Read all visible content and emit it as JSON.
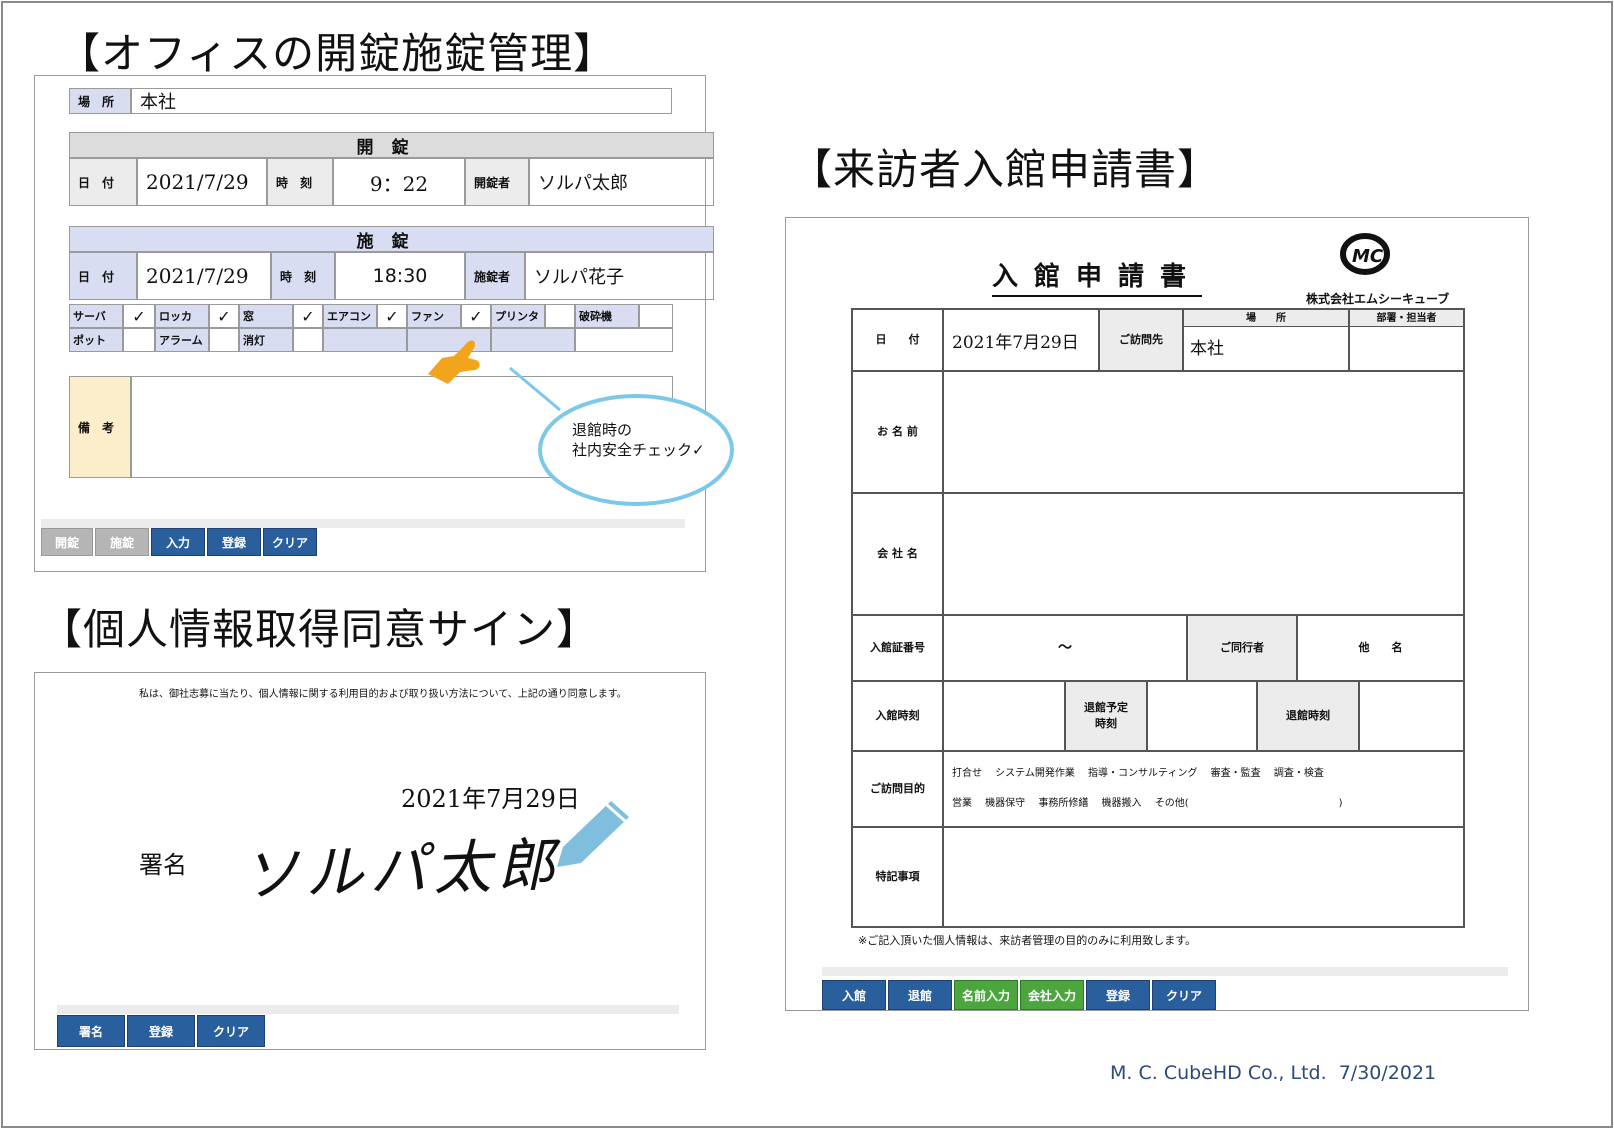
{
  "headings": {
    "office": "【オフィスの開錠施錠管理】",
    "visitor": "【来訪者入館申請書】",
    "consent": "【個人情報取得同意サイン】"
  },
  "lock_panel": {
    "place_label": "場　所",
    "place_value": "本社",
    "unlock_header": "開錠",
    "unlock": {
      "date_label": "日　付",
      "date": "2021/7/29",
      "time_label": "時　刻",
      "time": "9：22",
      "person_label": "開錠者",
      "person": "ソルパ太郎"
    },
    "lock_header": "施錠",
    "lock": {
      "date_label": "日　付",
      "date": "2021/7/29",
      "time_label": "時　刻",
      "time": "18:30",
      "person_label": "施錠者",
      "person": "ソルパ花子"
    },
    "checks_row1": [
      {
        "label": "サーバ",
        "mark": "✓"
      },
      {
        "label": "ロッカ",
        "mark": "✓"
      },
      {
        "label": "窓",
        "mark": "✓"
      },
      {
        "label": "エアコン",
        "mark": "✓"
      },
      {
        "label": "ファン",
        "mark": "✓"
      },
      {
        "label": "プリンタ",
        "mark": ""
      },
      {
        "label": "破砕機",
        "mark": ""
      }
    ],
    "checks_row2": [
      {
        "label": "ポット"
      },
      {
        "label": "アラーム"
      },
      {
        "label": "消灯"
      }
    ],
    "remarks_label": "備　考",
    "callout": "退館時の\n社内安全チェック✓",
    "buttons": [
      {
        "label": "開錠",
        "style": "grey"
      },
      {
        "label": "施錠",
        "style": "grey"
      },
      {
        "label": "入力",
        "style": "blue"
      },
      {
        "label": "登録",
        "style": "blue"
      },
      {
        "label": "クリア",
        "style": "blue"
      }
    ]
  },
  "consent_panel": {
    "notice": "私は、御社志募に当たり、個人情報に関する利用目的および取り扱い方法について、上記の通り同意します。",
    "date": "2021年7月29日",
    "sign_label": "署名",
    "signature": "ソルパ太郎",
    "buttons": [
      {
        "label": "署名"
      },
      {
        "label": "登録"
      },
      {
        "label": "クリア"
      }
    ]
  },
  "visitor_form": {
    "title": "入館申請書",
    "company": "株式会社エムシーキューブ",
    "logo_text": "MC",
    "date_label": "日　　付",
    "date_value": "2021年7月29日",
    "visit_label": "ご訪問先",
    "place_header": "場　　所",
    "dept_header": "部署・担当者",
    "place_value": "本社",
    "name_label": "お 名 前",
    "company_label": "会 社 名",
    "badge_label": "入館証番号",
    "badge_value": "～",
    "companion_label": "ご同行者",
    "others_label": "他　　名",
    "entry_time_label": "入館時刻",
    "planned_exit_label": "退館予定\n時刻",
    "exit_time_label": "退館時刻",
    "purpose_label": "ご訪問目的",
    "purpose_line1": "打合せ　 システム開発作業　 指導・コンサルティング　 審査・監査　 調査・検査",
    "purpose_line2": "営業　 機器保守　 事務所修繕　 機器搬入　 その他(　　　　　　　　　　　　　　　)",
    "notes_label": "特記事項",
    "footnote": "※ご記入頂いた個人情報は、来訪者管理の目的のみに利用致します。",
    "buttons": [
      {
        "label": "入館",
        "style": "blue"
      },
      {
        "label": "退館",
        "style": "blue"
      },
      {
        "label": "名前入力",
        "style": "green"
      },
      {
        "label": "会社入力",
        "style": "green"
      },
      {
        "label": "登録",
        "style": "blue"
      },
      {
        "label": "クリア",
        "style": "blue"
      }
    ]
  },
  "footer": "M. C. CubeHD Co., Ltd.  7/30/2021",
  "colors": {
    "label_bg": "#d9ddf2",
    "remarks_bg": "#fdeecb",
    "button_blue": "#2a5f9e",
    "button_green": "#4aa63d",
    "callout_border": "#7cc8e8",
    "pointer": "#f2a51c",
    "pencil": "#7fbfdd"
  }
}
